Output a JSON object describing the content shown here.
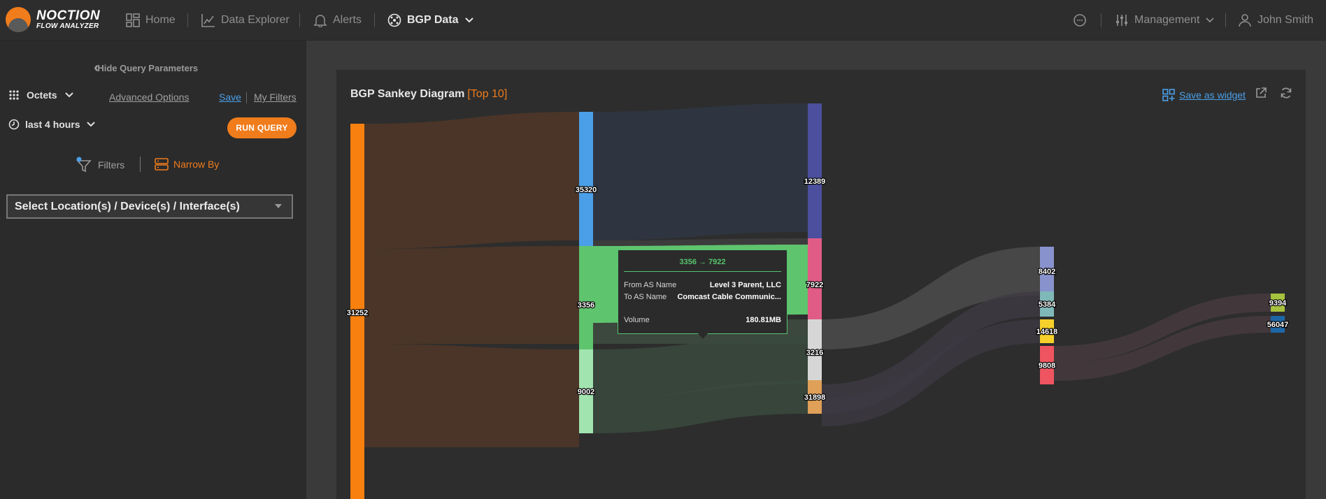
{
  "brand": {
    "name": "NOCTION",
    "sub": "FLOW ANALYZER"
  },
  "nav": {
    "home": "Home",
    "explorer": "Data Explorer",
    "alerts": "Alerts",
    "bgp": "BGP Data",
    "management": "Management",
    "user": "John Smith"
  },
  "sidebar": {
    "hide_params": "Hide Query Parameters",
    "metric": "Octets",
    "advanced": "Advanced Options",
    "save": "Save",
    "my_filters": "My Filters",
    "time_range": "last 4 hours",
    "run": "RUN QUERY",
    "filters": "Filters",
    "narrow_by": "Narrow By",
    "location_select": "Select Location(s) / Device(s) / Interface(s)"
  },
  "card": {
    "title": "BGP Sankey Diagram",
    "badge": "[Top 10]",
    "save_widget": "Save as widget"
  },
  "colors": {
    "accent": "#f07c1c",
    "link": "#4a9fe8",
    "tooltip_accent": "#56c46d"
  },
  "chart_data": {
    "type": "sankey",
    "nodes": [
      {
        "id": "31252",
        "column": 0,
        "color": "#f7800f"
      },
      {
        "id": "35320",
        "column": 1,
        "color": "#4a9fe8"
      },
      {
        "id": "3356",
        "column": 1,
        "color": "#5fc46e"
      },
      {
        "id": "9002",
        "column": 1,
        "color": "#a2e4b0"
      },
      {
        "id": "12389",
        "column": 2,
        "color": "#4b4f9d"
      },
      {
        "id": "7922",
        "column": 2,
        "color": "#e05c87"
      },
      {
        "id": "3216",
        "column": 2,
        "color": "#d6d6d6"
      },
      {
        "id": "31898",
        "column": 2,
        "color": "#dfa058"
      },
      {
        "id": "8402",
        "column": 3,
        "color": "#8892cd"
      },
      {
        "id": "5384",
        "column": 3,
        "color": "#7fb8b8"
      },
      {
        "id": "14618",
        "column": 3,
        "color": "#f5d02a"
      },
      {
        "id": "9808",
        "column": 3,
        "color": "#ee5560"
      },
      {
        "id": "9394",
        "column": 4,
        "color": "#a7c23e"
      },
      {
        "id": "56047",
        "column": 4,
        "color": "#1e67a6"
      }
    ],
    "tooltip": {
      "header": "3356 → 7922",
      "from_label": "From AS Name",
      "from_value": "Level 3 Parent, LLC",
      "to_label": "To AS Name",
      "to_value": "Comcast Cable Communic...",
      "volume_label": "Volume",
      "volume_value": "180.81MB"
    }
  }
}
